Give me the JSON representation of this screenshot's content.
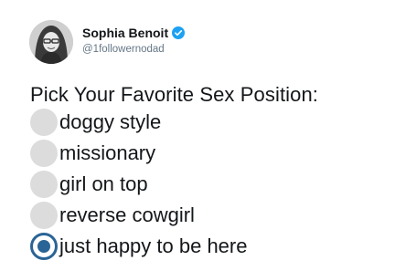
{
  "author": {
    "display_name": "Sophia Benoit",
    "handle": "@1followernodad",
    "verified": true
  },
  "tweet": {
    "question": "Pick Your Favorite Sex Position:",
    "options": [
      {
        "label": "doggy style",
        "selected": false
      },
      {
        "label": "missionary",
        "selected": false
      },
      {
        "label": "girl on top",
        "selected": false
      },
      {
        "label": "reverse cowgirl",
        "selected": false
      },
      {
        "label": "just happy to be here",
        "selected": true
      }
    ]
  },
  "colors": {
    "verified_badge": "#1da1f2",
    "selected_radio": "#2a6496",
    "unselected_radio": "#dcdcdc",
    "handle_text": "#657786"
  },
  "icons": {
    "avatar": "profile-photo",
    "verified": "verified-badge-icon"
  }
}
